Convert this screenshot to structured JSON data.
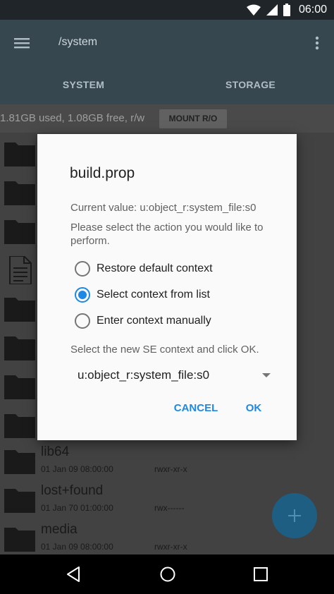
{
  "status_bar": {
    "time": "06:00",
    "icons": [
      "wifi-icon",
      "signal-icon",
      "battery-icon"
    ]
  },
  "app_bar": {
    "path": "/system",
    "tabs": [
      {
        "label": "SYSTEM"
      },
      {
        "label": "STORAGE"
      }
    ]
  },
  "info_bar": {
    "usage": "1.81GB used, 1.08GB free, r/w",
    "mount_button": "MOUNT R/O"
  },
  "files": [
    {
      "name": "lib64",
      "date": "01 Jan 09 08:00:00",
      "perm": "rwxr-xr-x"
    },
    {
      "name": "lost+found",
      "date": "01 Jan 70 01:00:00",
      "perm": "rwx------"
    },
    {
      "name": "media",
      "date": "01 Jan 09 08:00:00",
      "perm": "rwxr-xr-x"
    }
  ],
  "dialog": {
    "title": "build.prop",
    "current_value": "Current value: u:object_r:system_file:s0",
    "prompt": "Please select the action you would like to perform.",
    "options": [
      {
        "label": "Restore default context",
        "checked": false
      },
      {
        "label": "Select context from list",
        "checked": true
      },
      {
        "label": "Enter context manually",
        "checked": false
      }
    ],
    "hint": "Select the new SE context and click OK.",
    "selected_context": "u:object_r:system_file:s0",
    "cancel_label": "CANCEL",
    "ok_label": "OK"
  },
  "colors": {
    "accent": "#1e88e5",
    "app_bar": "#37474f",
    "fab": "#1e5e83"
  }
}
